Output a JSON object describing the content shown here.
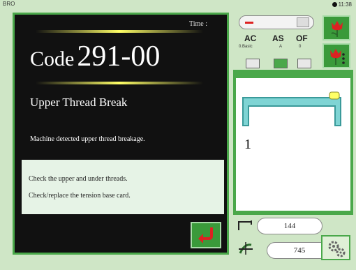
{
  "header": {
    "brand": "BRO",
    "clock": "11:38"
  },
  "error": {
    "time_label": "Time :",
    "code_word": "Code",
    "code_number": "291-00",
    "title": "Upper Thread Break",
    "description": "Machine detected upper thread breakage.",
    "hints": [
      "Check the upper and under threads.",
      "Check/replace the tension base card."
    ]
  },
  "controls": {
    "ac": "AC",
    "as": "AS",
    "of": "OF",
    "sub_left": "0.Basic",
    "sub_mid": "A",
    "sub_right": "0"
  },
  "diagram": {
    "number": "1"
  },
  "counters": {
    "stitch_count": "144",
    "speed": "745"
  },
  "icons": {
    "back": "return-arrow-icon",
    "tulip": "tulip-icon",
    "gear": "gears-icon",
    "thread": "thread-icon",
    "needle": "needle-icon"
  },
  "colors": {
    "panel_green": "#4aa84a",
    "background": "#cfe6c6",
    "alert_red": "#dd2222",
    "highlight_yellow": "#ffff66"
  }
}
